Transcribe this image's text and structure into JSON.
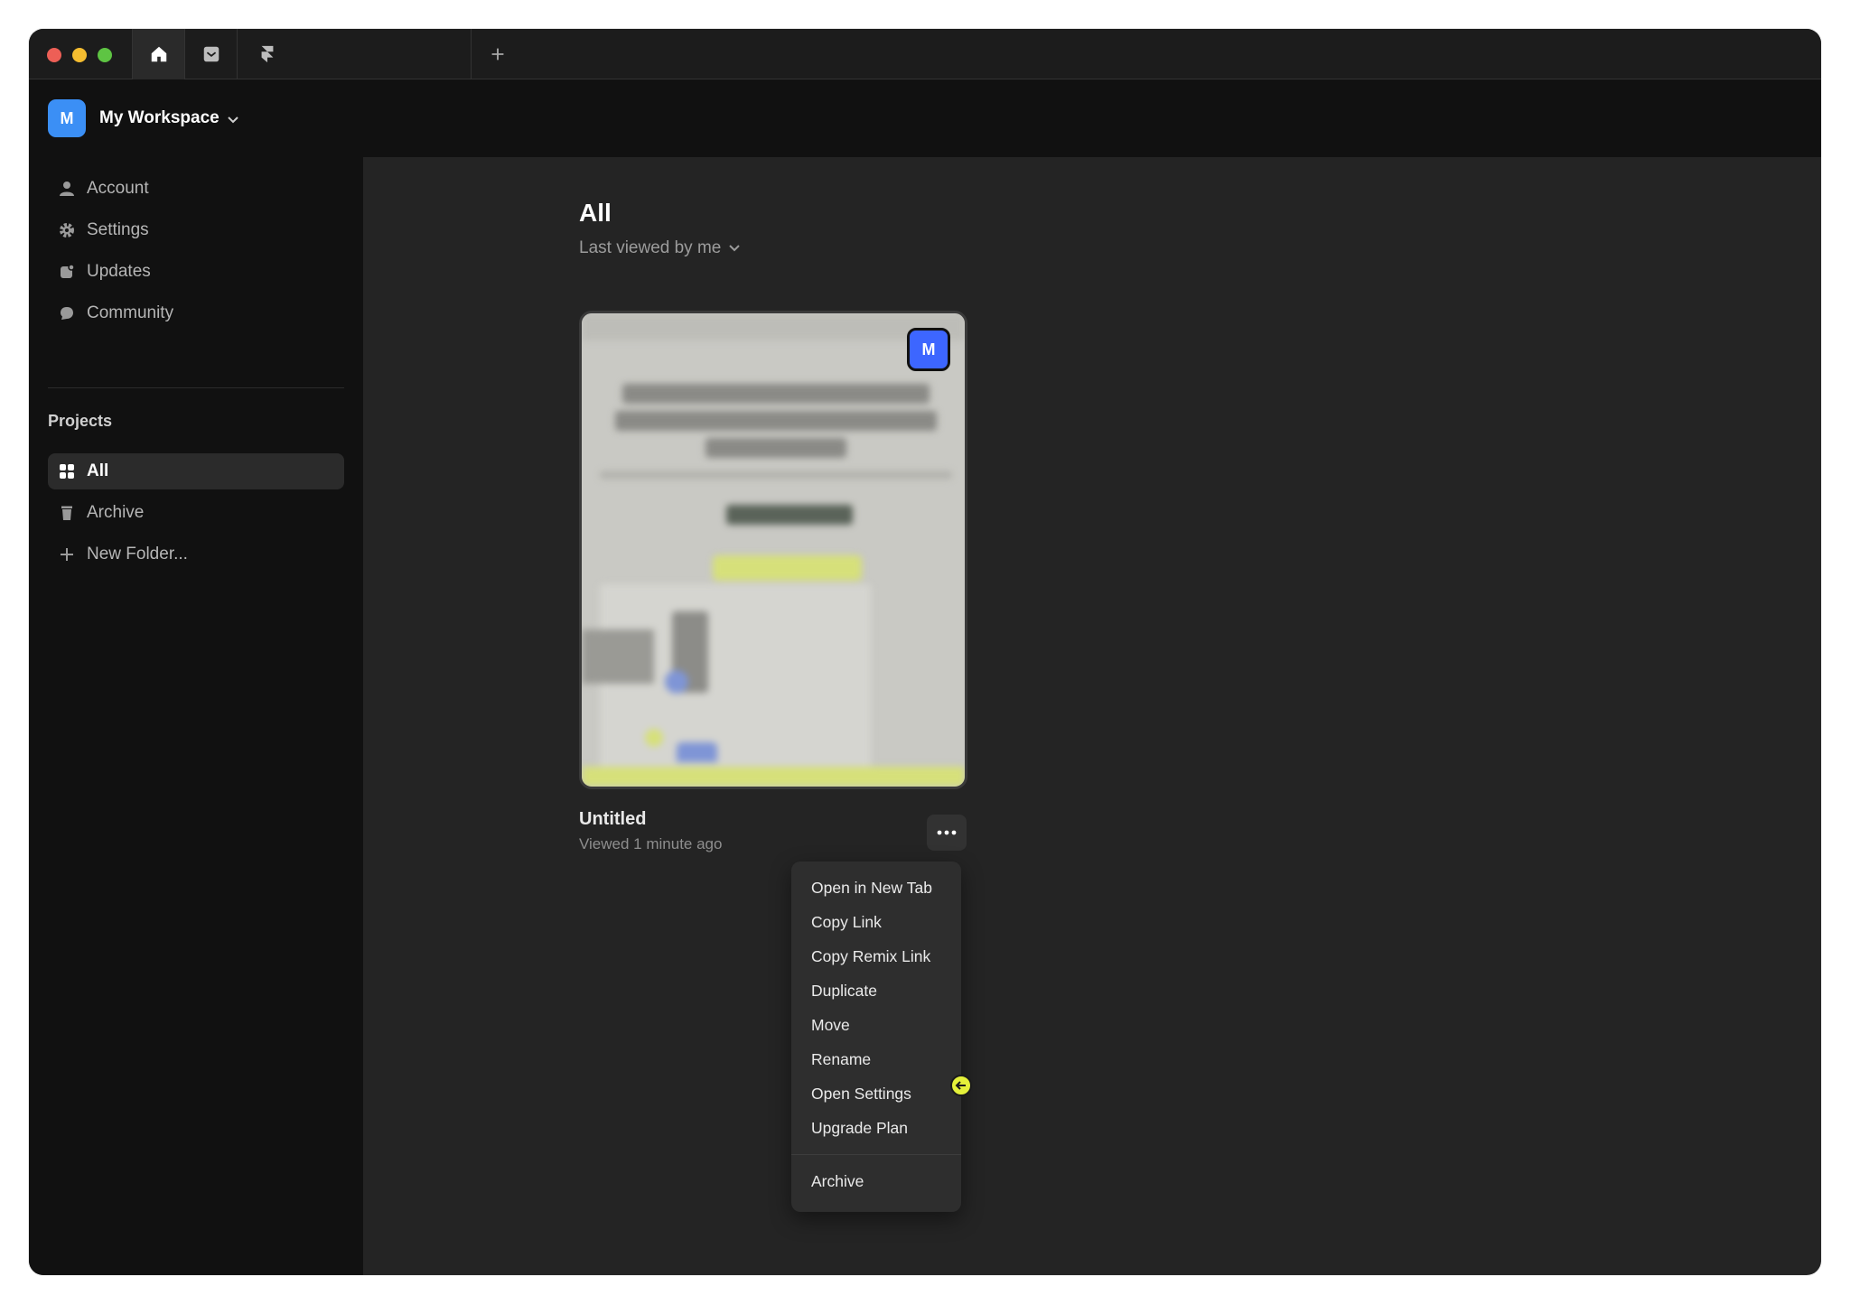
{
  "tabs": {
    "home_icon": "home-icon",
    "inbox_icon": "inbox-icon",
    "framer_icon": "framer-logo-icon",
    "new_tab_icon": "plus-icon"
  },
  "workspace": {
    "avatar_letter": "M",
    "name": "My Workspace"
  },
  "sidebar": {
    "account": "Account",
    "settings": "Settings",
    "updates": "Updates",
    "community": "Community",
    "projects_title": "Projects",
    "all": "All",
    "archive": "Archive",
    "new_folder": "New Folder..."
  },
  "main": {
    "title": "All",
    "sort_label": "Last viewed by me"
  },
  "project": {
    "avatar_letter": "M",
    "name": "Untitled",
    "meta": "Viewed 1 minute ago"
  },
  "context_menu": {
    "items": [
      "Open in New Tab",
      "Copy Link",
      "Copy Remix Link",
      "Duplicate",
      "Move",
      "Rename",
      "Open Settings",
      "Upgrade Plan"
    ],
    "archive": "Archive"
  },
  "colors": {
    "accent_blue": "#3b8ff5",
    "card_avatar": "#3d66ff",
    "cursor": "#e4f03a"
  }
}
